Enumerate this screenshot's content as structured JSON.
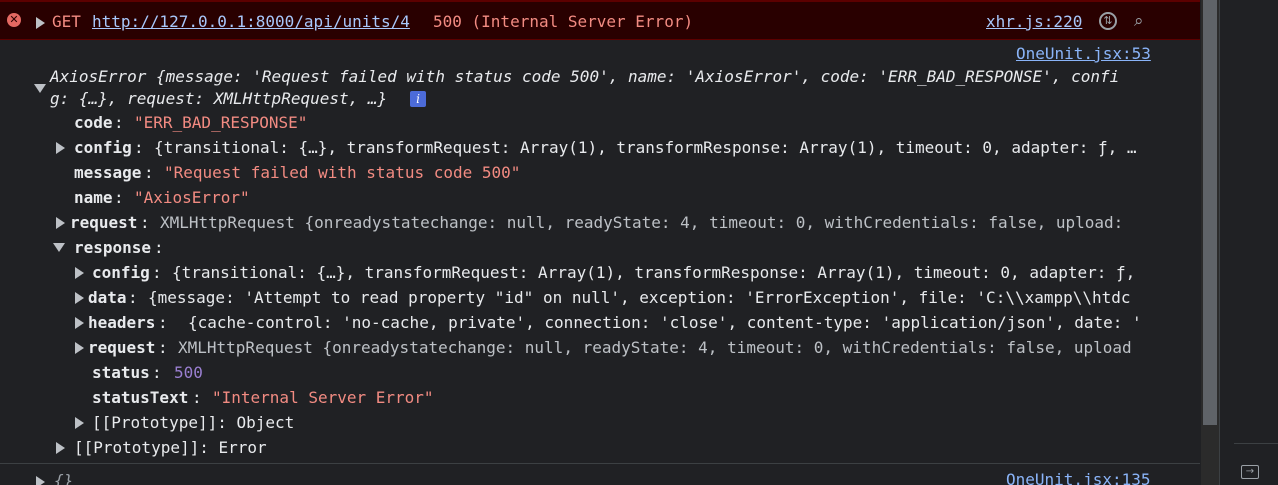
{
  "error_bar": {
    "method": "GET",
    "url": "http://127.0.0.1:8000/api/units/4",
    "status": "500 (Internal Server Error)",
    "source": "xhr.js:220"
  },
  "source_link_1": "OneUnit.jsx:53",
  "source_link_2": "OneUnit.jsx:135",
  "axios_header": {
    "line1": "AxiosError {message: 'Request failed with status code 500', name: 'AxiosError', code: 'ERR_BAD_RESPONSE', confi",
    "line2": "g: {…}, request: XMLHttpRequest, …}",
    "info": "i"
  },
  "props": {
    "code_key": "code",
    "code_val": "\"ERR_BAD_RESPONSE\"",
    "config_key": "config",
    "config_val": "{transitional: {…}, transformRequest: Array(1), transformResponse: Array(1), timeout: 0, adapter: ƒ, …",
    "message_key": "message",
    "message_val": "\"Request failed with status code 500\"",
    "name_key": "name",
    "name_val": "\"AxiosError\"",
    "request_key": "request",
    "request_val": "XMLHttpRequest {onreadystatechange: null, readyState: 4, timeout: 0, withCredentials: false, upload:",
    "response_key": "response",
    "resp_config_key": "config",
    "resp_config_val": "{transitional: {…}, transformRequest: Array(1), transformResponse: Array(1), timeout: 0, adapter: ƒ,",
    "data_key": "data",
    "data_val": "{message: 'Attempt to read property \"id\" on null', exception: 'ErrorException', file: 'C:\\\\xampp\\\\htdc",
    "headers_key": "headers",
    "headers_val": "{cache-control: 'no-cache, private', connection: 'close', content-type: 'application/json', date: '",
    "resp_request_key": "request",
    "resp_request_val": "XMLHttpRequest {onreadystatechange: null, readyState: 4, timeout: 0, withCredentials: false, upload",
    "status_key": "status",
    "status_val": "500",
    "statustext_key": "statusText",
    "statustext_val": "\"Internal Server Error\"",
    "proto_obj": "[[Prototype]]: Object",
    "proto_err": "[[Prototype]]: Error"
  },
  "next_row": "{}"
}
